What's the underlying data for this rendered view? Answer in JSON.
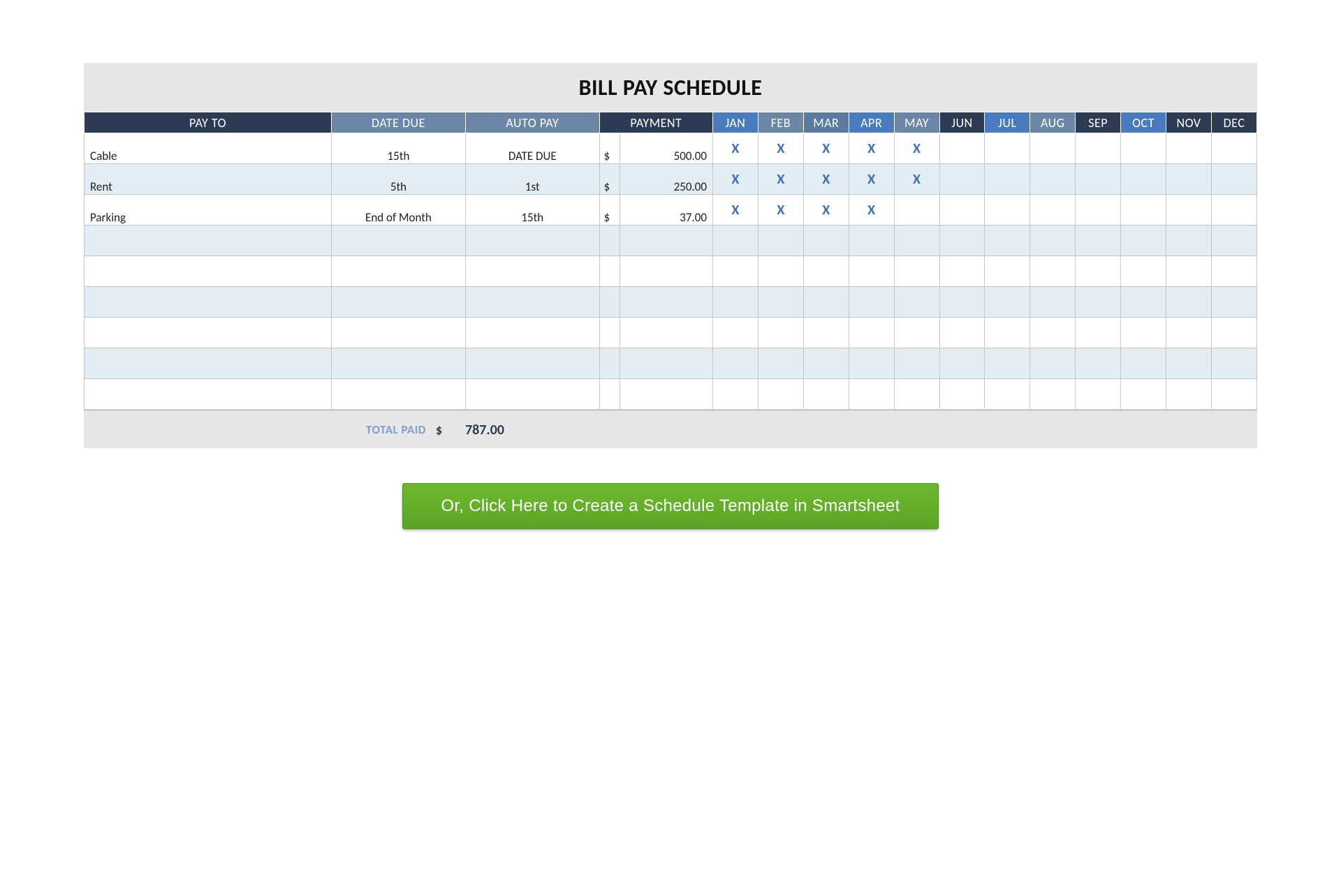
{
  "title": "BILL PAY SCHEDULE",
  "headers": {
    "payto": "PAY TO",
    "due": "DATE DUE",
    "auto": "AUTO PAY",
    "payment": "PAYMENT",
    "months": [
      "JAN",
      "FEB",
      "MAR",
      "APR",
      "MAY",
      "JUN",
      "JUL",
      "AUG",
      "SEP",
      "OCT",
      "NOV",
      "DEC"
    ]
  },
  "month_colors": [
    "blue",
    "steel",
    "steel2",
    "blue",
    "steel",
    "dark",
    "blue",
    "steel",
    "dark",
    "blue",
    "dark",
    "dark"
  ],
  "rows": [
    {
      "payto": "Cable",
      "due": "15th",
      "auto": "DATE DUE",
      "sym": "$",
      "amount": "500.00",
      "marks": [
        "X",
        "X",
        "X",
        "X",
        "X",
        "",
        "",
        "",
        "",
        "",
        "",
        ""
      ]
    },
    {
      "payto": "Rent",
      "due": "5th",
      "auto": "1st",
      "sym": "$",
      "amount": "250.00",
      "marks": [
        "X",
        "X",
        "X",
        "X",
        "X",
        "",
        "",
        "",
        "",
        "",
        "",
        ""
      ]
    },
    {
      "payto": "Parking",
      "due": "End of Month",
      "auto": "15th",
      "sym": "$",
      "amount": "37.00",
      "marks": [
        "X",
        "X",
        "X",
        "X",
        "",
        "",
        "",
        "",
        "",
        "",
        "",
        ""
      ]
    },
    {
      "payto": "",
      "due": "",
      "auto": "",
      "sym": "",
      "amount": "",
      "marks": [
        "",
        "",
        "",
        "",
        "",
        "",
        "",
        "",
        "",
        "",
        "",
        ""
      ]
    },
    {
      "payto": "",
      "due": "",
      "auto": "",
      "sym": "",
      "amount": "",
      "marks": [
        "",
        "",
        "",
        "",
        "",
        "",
        "",
        "",
        "",
        "",
        "",
        ""
      ]
    },
    {
      "payto": "",
      "due": "",
      "auto": "",
      "sym": "",
      "amount": "",
      "marks": [
        "",
        "",
        "",
        "",
        "",
        "",
        "",
        "",
        "",
        "",
        "",
        ""
      ]
    },
    {
      "payto": "",
      "due": "",
      "auto": "",
      "sym": "",
      "amount": "",
      "marks": [
        "",
        "",
        "",
        "",
        "",
        "",
        "",
        "",
        "",
        "",
        "",
        ""
      ]
    },
    {
      "payto": "",
      "due": "",
      "auto": "",
      "sym": "",
      "amount": "",
      "marks": [
        "",
        "",
        "",
        "",
        "",
        "",
        "",
        "",
        "",
        "",
        "",
        ""
      ]
    },
    {
      "payto": "",
      "due": "",
      "auto": "",
      "sym": "",
      "amount": "",
      "marks": [
        "",
        "",
        "",
        "",
        "",
        "",
        "",
        "",
        "",
        "",
        "",
        ""
      ]
    }
  ],
  "total": {
    "label": "TOTAL PAID",
    "sym": "$",
    "value": "787.00"
  },
  "cta": "Or, Click Here to Create a Schedule Template in Smartsheet"
}
